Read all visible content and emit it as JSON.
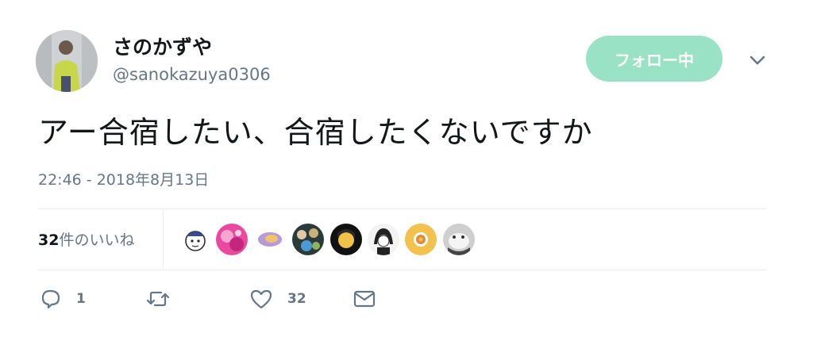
{
  "author": {
    "display_name": "さのかずや",
    "handle": "@sanokazuya0306"
  },
  "follow_button": {
    "label": "フォロー中"
  },
  "tweet": {
    "text": "アー合宿したい、合宿したくないですか",
    "timestamp": "22:46 - 2018年8月13日"
  },
  "stats": {
    "likes_count": "32",
    "likes_suffix": "件のいいね"
  },
  "actions": {
    "reply_count": "1",
    "retweet_count": "",
    "like_count": "32"
  },
  "colors": {
    "follow_button_bg": "#9ae2c5",
    "secondary_text": "#657786",
    "divider": "#e6ecf0"
  },
  "icons": [
    "chevron-down-icon",
    "reply-icon",
    "retweet-icon",
    "heart-icon",
    "envelope-icon"
  ]
}
